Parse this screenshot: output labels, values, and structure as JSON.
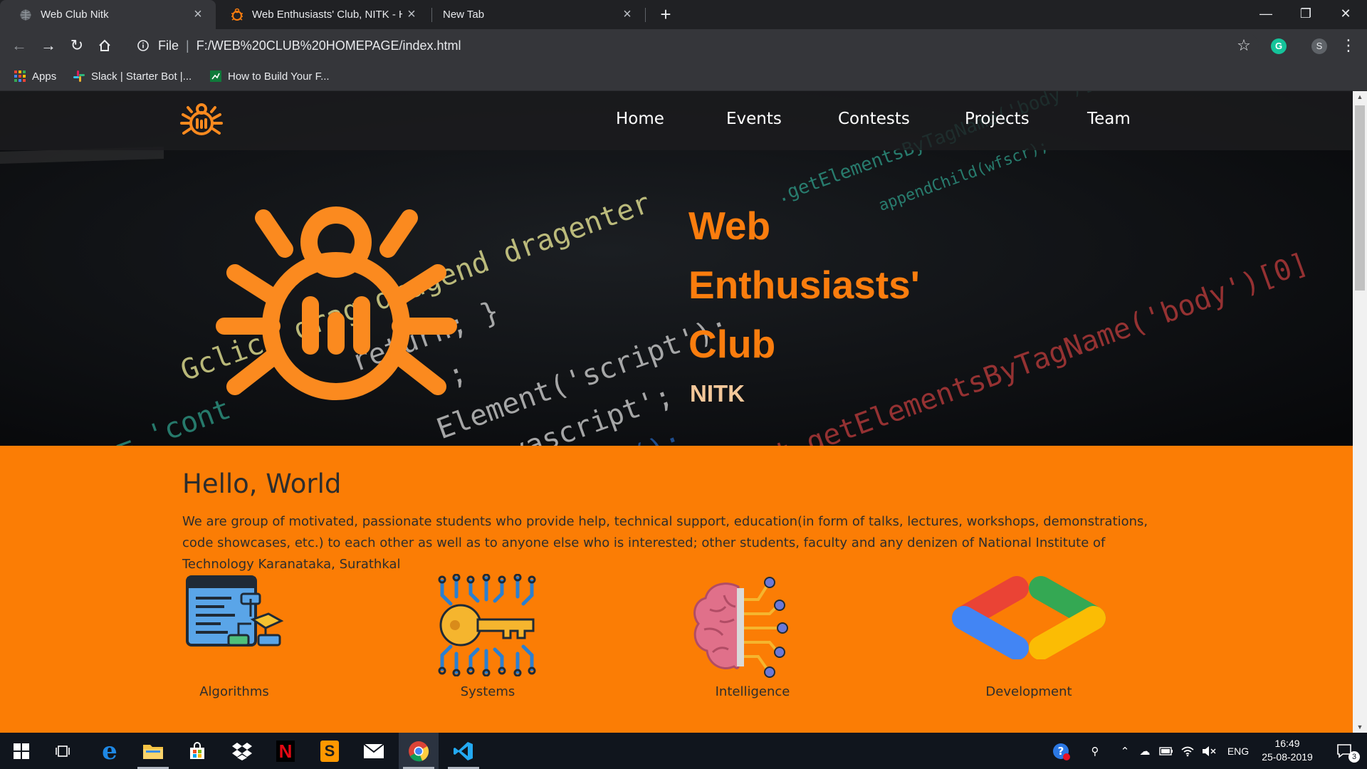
{
  "browser": {
    "tabs": [
      {
        "title": "Web Club Nitk",
        "active": true
      },
      {
        "title": "Web Enthusiasts' Club, NITK - Ho",
        "active": false
      },
      {
        "title": "New Tab",
        "active": false
      }
    ],
    "new_tab_label": "+",
    "window_controls": {
      "minimize": "—",
      "restore": "❐",
      "close": "✕"
    },
    "address": {
      "scheme": "File",
      "url": "F:/WEB%20CLUB%20HOMEPAGE/index.html"
    },
    "profile_initial": "S",
    "extension_initial": "G",
    "bookmarks": [
      {
        "label": "Apps"
      },
      {
        "label": "Slack | Starter Bot |..."
      },
      {
        "label": "How to Build Your F..."
      }
    ]
  },
  "site": {
    "nav": [
      "Home",
      "Events",
      "Contests",
      "Projects",
      "Team"
    ],
    "hero": {
      "title_lines": [
        "Web",
        "Enthusiasts'",
        "Club"
      ],
      "subtitle": "NITK"
    },
    "about": {
      "heading": "Hello, World",
      "text": "We are group of motivated, passionate students who provide help, technical support, education(in form of talks, lectures, workshops, demonstrations, code showcases, etc.) to each other as well as to anyone else who is interested; other students, faculty and any denizen of National Institute of Technology Karanataka, Surathkal"
    },
    "features": [
      {
        "label": "Algorithms",
        "icon": "flowchart-icon"
      },
      {
        "label": "Systems",
        "icon": "circuit-key-icon"
      },
      {
        "label": "Intelligence",
        "icon": "brain-circuit-icon"
      },
      {
        "label": "Development",
        "icon": "dev-chevrons-icon"
      }
    ],
    "brand_color": "#fb7d05"
  },
  "taskbar": {
    "language": "ENG",
    "time": "16:49",
    "date": "25-08-2019",
    "notification_count": "3"
  }
}
